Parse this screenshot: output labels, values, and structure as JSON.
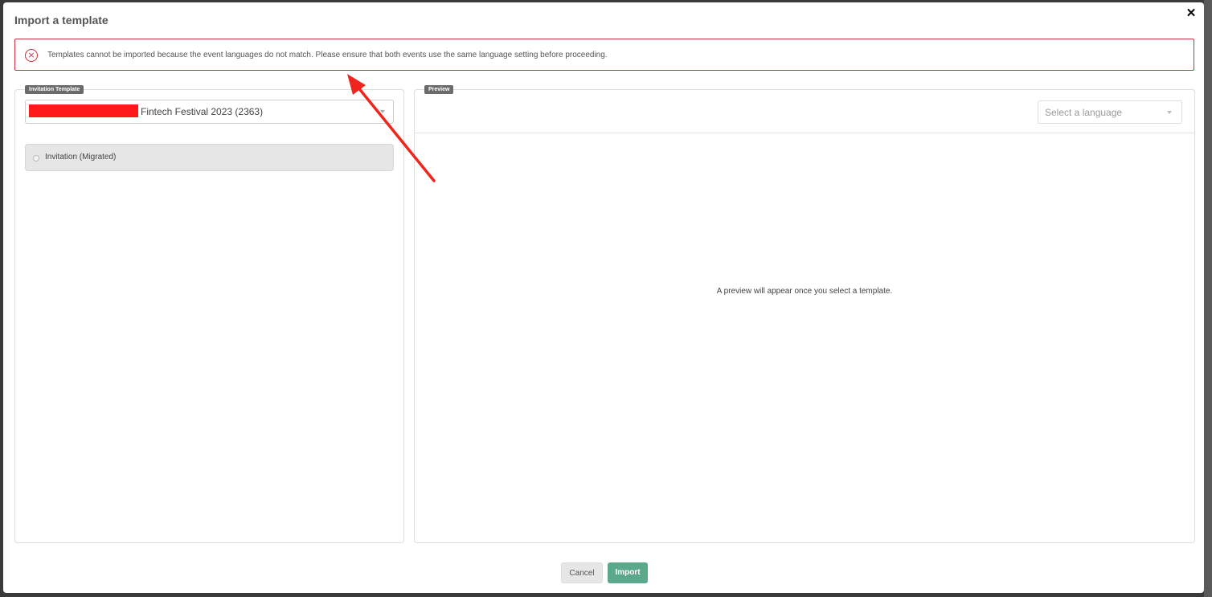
{
  "modal": {
    "title": "Import a template",
    "close_label": "✕"
  },
  "alert": {
    "icon": "error-circle-icon",
    "message": "Templates cannot be imported because the event languages do not match. Please ensure that both events use the same language setting before proceeding.",
    "color": "#c9303c"
  },
  "left_panel": {
    "tag": "Invitation Template",
    "event_select_value": "Fintech Festival 2023 (2363)",
    "templates": [
      {
        "label": "Invitation (Migrated)"
      }
    ]
  },
  "right_panel": {
    "tag": "Preview",
    "language_placeholder": "Select a language",
    "empty_message": "A preview will appear once you select a template."
  },
  "footer": {
    "cancel_label": "Cancel",
    "import_label": "Import",
    "import_color": "#5aa98a"
  },
  "annotation": {
    "arrow_color": "#f0251d"
  }
}
